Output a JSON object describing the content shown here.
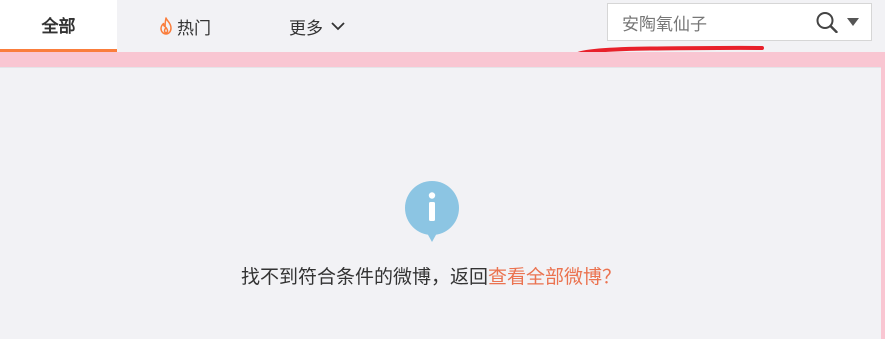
{
  "tabs": {
    "all_label": "全部",
    "hot_label": "热门",
    "more_label": "更多"
  },
  "search": {
    "value": "安陶氧仙子",
    "placeholder": ""
  },
  "empty_state": {
    "message": "找不到符合条件的微博，返回",
    "link_text": "查看全部微博",
    "suffix": "？"
  },
  "icons": {
    "hot": "flame-icon",
    "more": "chevron-down-icon",
    "search": "search-icon",
    "dropdown": "caret-down-icon",
    "info": "info-icon"
  },
  "colors": {
    "accent": "#fa7d3c",
    "link": "#eb7350",
    "info_bubble": "#8cc5e3",
    "annotation_red": "#e8202a",
    "pink_strip": "#f9c6d2",
    "background": "#f2f2f5"
  }
}
